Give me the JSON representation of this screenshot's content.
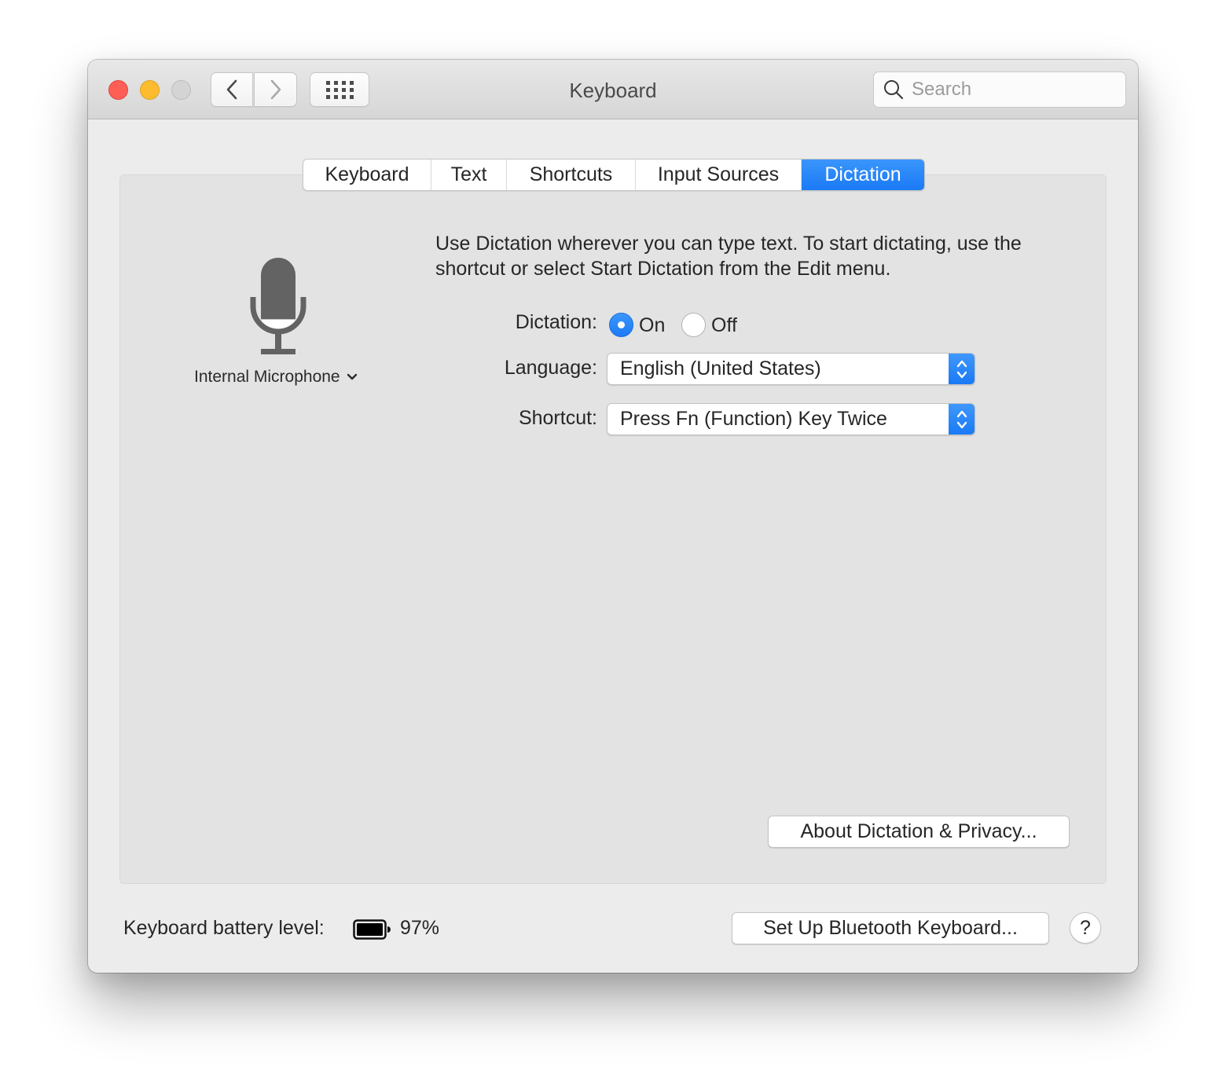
{
  "window": {
    "title": "Keyboard",
    "traffic_lights": {
      "close": "#fd5e56",
      "minimize": "#fdbc2e",
      "zoom": "#d4d4d4"
    }
  },
  "toolbar": {
    "back_icon": "chevron-left-icon",
    "forward_icon": "chevron-right-icon",
    "show_all_icon": "grid-icon",
    "search": {
      "placeholder": "Search",
      "value": "",
      "icon": "search-icon"
    }
  },
  "tabs": [
    {
      "label": "Keyboard",
      "active": false
    },
    {
      "label": "Text",
      "active": false
    },
    {
      "label": "Shortcuts",
      "active": false
    },
    {
      "label": "Input Sources",
      "active": false
    },
    {
      "label": "Dictation",
      "active": true
    }
  ],
  "dictation": {
    "microphone": {
      "icon": "microphone-icon",
      "label": "Internal Microphone",
      "level_fraction": 0.2
    },
    "description": "Use Dictation wherever you can type text. To start dictating, use the shortcut or select Start Dictation from the Edit menu.",
    "dictation_label": "Dictation:",
    "options": [
      {
        "label": "On",
        "selected": true
      },
      {
        "label": "Off",
        "selected": false
      }
    ],
    "language_label": "Language:",
    "language_value": "English (United States)",
    "shortcut_label": "Shortcut:",
    "shortcut_value": "Press Fn (Function) Key Twice",
    "about_button": "About Dictation & Privacy..."
  },
  "footer": {
    "battery_label": "Keyboard battery level:",
    "battery_percent": 97,
    "battery_text": "97%",
    "bluetooth_button": "Set Up Bluetooth Keyboard...",
    "help_button": "?"
  },
  "colors": {
    "accent": "#1d7bf5",
    "window_bg": "#ececec",
    "panel_bg": "#e3e3e3"
  }
}
